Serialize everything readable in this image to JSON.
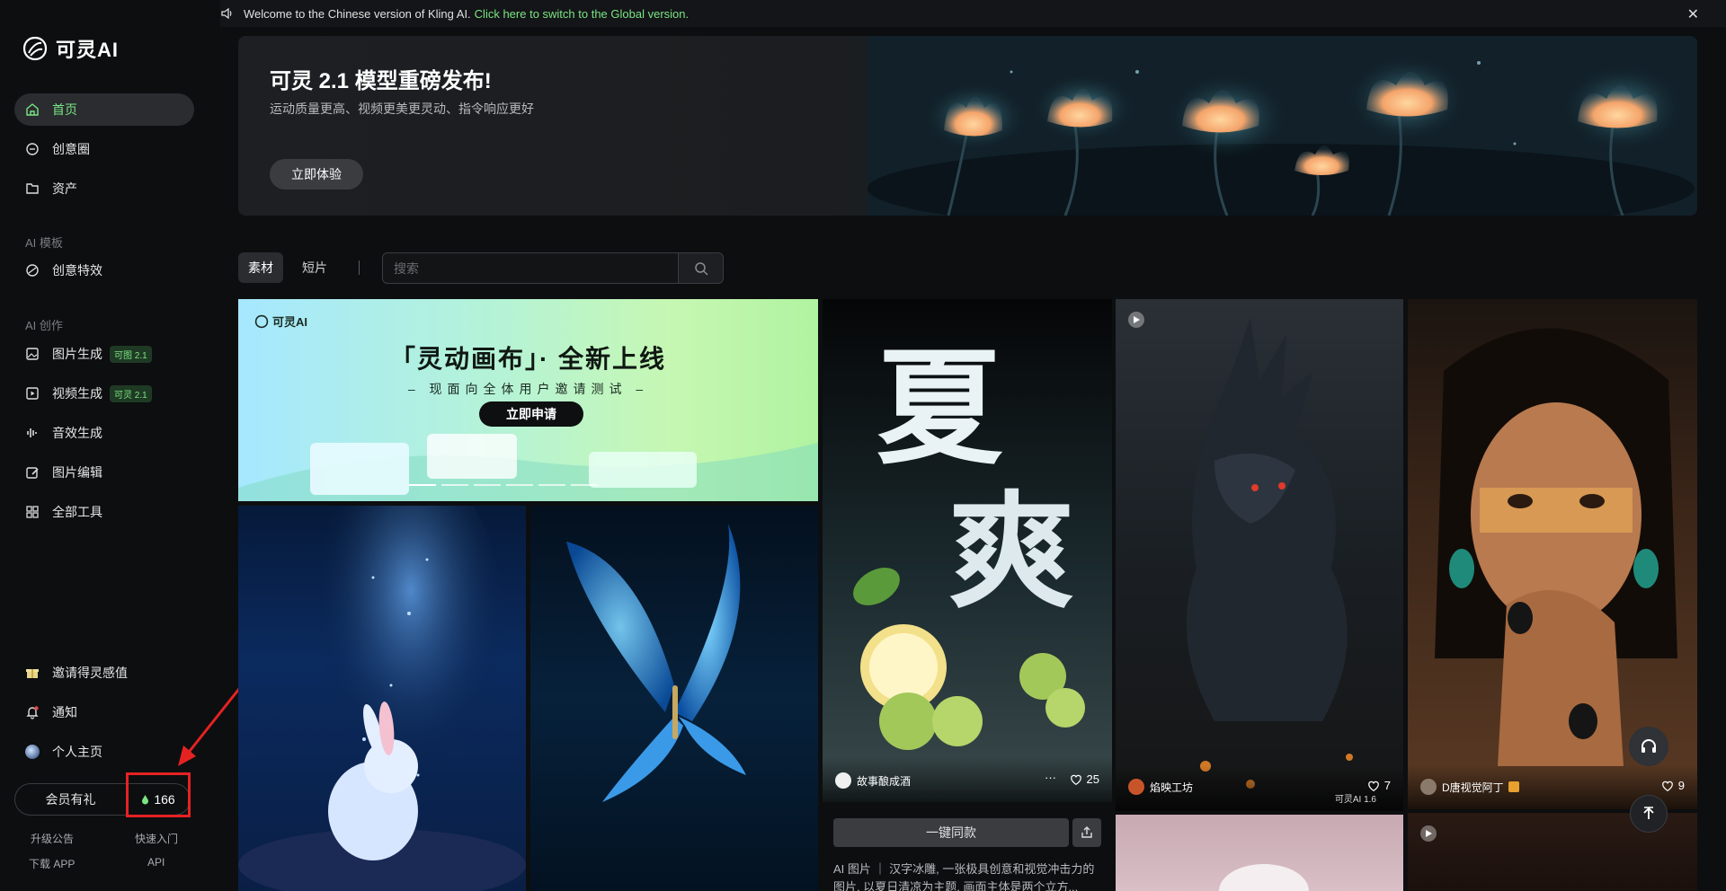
{
  "topbar": {
    "welcome": "Welcome to the Chinese version of Kling AI.",
    "switch_link": "Click here to switch to the Global version.",
    "close": "✕"
  },
  "sidebar": {
    "logo": "可灵AI",
    "items": [
      {
        "label": "首页",
        "icon": "home-icon",
        "active": true
      },
      {
        "label": "创意圈",
        "icon": "community-icon"
      },
      {
        "label": "资产",
        "icon": "folder-icon"
      }
    ],
    "section_templates": "AI 模板",
    "templates": [
      {
        "label": "创意特效",
        "icon": "effects-icon"
      }
    ],
    "section_create": "AI 创作",
    "create": [
      {
        "label": "图片生成",
        "icon": "image-icon",
        "tag": "可图 2.1"
      },
      {
        "label": "视频生成",
        "icon": "video-icon",
        "tag": "可灵 2.1"
      },
      {
        "label": "音效生成",
        "icon": "audio-icon"
      },
      {
        "label": "图片编辑",
        "icon": "edit-icon"
      },
      {
        "label": "全部工具",
        "icon": "grid-icon"
      }
    ],
    "bottom": [
      {
        "label": "邀请得灵感值",
        "icon": "gift-icon"
      },
      {
        "label": "通知",
        "icon": "bell-icon"
      },
      {
        "label": "个人主页",
        "icon": "avatar"
      }
    ],
    "vip_label": "会员有礼",
    "points": "166",
    "links": [
      "升级公告",
      "快速入门",
      "下载 APP",
      "API"
    ]
  },
  "hero": {
    "title": "可灵 2.1 模型重磅发布!",
    "subtitle": "运动质量更高、视频更美更灵动、指令响应更好",
    "button": "立即体验"
  },
  "filters": {
    "tabs": [
      "素材",
      "短片"
    ],
    "search_placeholder": "搜索"
  },
  "promo": {
    "logo": "可灵AI",
    "title": "「灵动画布」· 全新上线",
    "subtitle": "– 现面向全体用户邀请测试 –",
    "button": "立即申请"
  },
  "cards": [
    {
      "author": "故事酿成酒",
      "likes": "25",
      "more": "···"
    },
    {
      "author": "焰映工坊",
      "likes": "7",
      "model": "可灵AI 1.6"
    },
    {
      "author": "D唐视觉阿丁",
      "likes": "9"
    }
  ],
  "card_actions": {
    "one_click": "一键同款",
    "desc": "AI 图片 ｜ 汉字冰雕, 一张极具创意和视觉冲击力的图片, 以夏日清凉为主题, 画面主体是两个立方..."
  },
  "colors": {
    "accent": "#7ae582",
    "annotation": "#e52222"
  }
}
